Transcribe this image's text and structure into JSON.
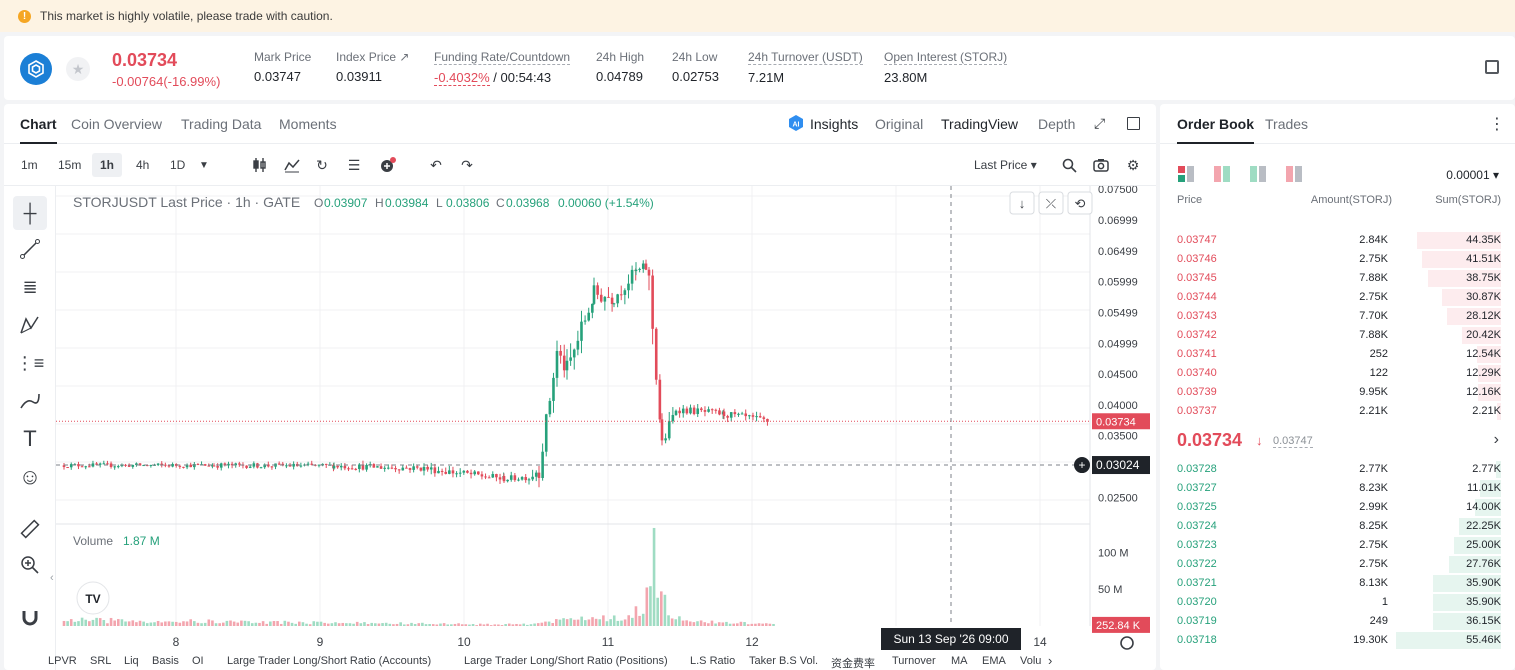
{
  "banner": {
    "message": "This market is highly volatile, please trade with caution."
  },
  "ticker": {
    "last_price": "0.03734",
    "change": "-0.00764(-16.99%)",
    "stats": [
      {
        "label": "Mark Price",
        "value": "0.03747",
        "x": 250
      },
      {
        "label": "Index Price ↗",
        "value": "0.03911",
        "x": 332
      },
      {
        "label": "Funding Rate/Countdown",
        "value_neg": "-0.4032%",
        "value_rest": " / 00:54:43",
        "x": 430,
        "ul": true
      },
      {
        "label": "24h High",
        "value": "0.04789",
        "x": 592
      },
      {
        "label": "24h Low",
        "value": "0.02753",
        "x": 668
      },
      {
        "label": "24h Turnover (USDT)",
        "value": "7.21M",
        "x": 744,
        "ul": true
      },
      {
        "label": "Open Interest (STORJ)",
        "value": "23.80M",
        "x": 880,
        "ul": true
      }
    ]
  },
  "chart_tabs": {
    "chart": "Chart",
    "coin_overview": "Coin Overview",
    "trading_data": "Trading Data",
    "moments": "Moments",
    "insights": "Insights",
    "original": "Original",
    "tradingview": "TradingView",
    "depth": "Depth"
  },
  "timeframes": [
    "1m",
    "15m",
    "1h",
    "4h",
    "1D"
  ],
  "price_type": "Last Price ▾",
  "legend": {
    "symbol": "STORJUSDT Last Price · 1h · GATE",
    "o_lbl": "O",
    "o": "0.03907",
    "h_lbl": "H",
    "h": "0.03984",
    "l_lbl": "L",
    "l": "0.03806",
    "c_lbl": "C",
    "c": "0.03968",
    "chg": "0.00060 (+1.54%)"
  },
  "volume_legend": {
    "label": "Volume",
    "value": "1.87 M"
  },
  "bottom_indicators": [
    "LPVR",
    "SRL",
    "Liq",
    "Basis",
    "OI",
    "Large Trader Long/Short Ratio (Accounts)",
    "Large Trader Long/Short Ratio (Positions)",
    "L.S Ratio",
    "Taker B.S Vol.",
    "资金费率",
    "Turnover",
    "MA",
    "EMA",
    "Volu"
  ],
  "chart_data": {
    "type": "candlestick",
    "price_axis_ticks": [
      "0.07500",
      "0.06999",
      "0.06499",
      "0.05999",
      "0.05499",
      "0.04999",
      "0.04500",
      "0.04000",
      "0.03500",
      "0.02500"
    ],
    "volume_axis_ticks": [
      "100 M",
      "50 M"
    ],
    "x_ticks": [
      "8",
      "9",
      "10",
      "11",
      "12",
      "14"
    ],
    "last_price_label": "0.03734",
    "crosshair_price_label": "0.03024",
    "crosshair_time_label": "Sun 13 Sep '26   09:00",
    "last_volume_label": "252.84 K",
    "ylim": [
      0.021,
      0.0755
    ],
    "vol_max": 125,
    "segments": [
      [
        0,
        0.0302,
        0.0302,
        150,
        0.00035
      ],
      [
        150,
        0.0302,
        0.0301,
        270,
        0.0004
      ],
      [
        270,
        0.0301,
        0.0297,
        360,
        0.0005
      ],
      [
        360,
        0.0297,
        0.028,
        440,
        0.0006
      ],
      [
        440,
        0.028,
        0.0283,
        465,
        0.0005
      ],
      [
        465,
        0.0283,
        0.0296,
        475,
        0.0009
      ],
      [
        475,
        0.0296,
        0.0485,
        493,
        0.0015
      ],
      [
        493,
        0.0485,
        0.0455,
        503,
        0.0015
      ],
      [
        503,
        0.0455,
        0.058,
        530,
        0.0018
      ],
      [
        530,
        0.058,
        0.0575,
        550,
        0.0015
      ],
      [
        550,
        0.0575,
        0.0615,
        572,
        0.0012
      ],
      [
        572,
        0.0615,
        0.0622,
        582,
        0.001
      ],
      [
        582,
        0.0622,
        0.06,
        585,
        0.0008
      ],
      [
        585,
        0.06,
        0.0335,
        598,
        0.002
      ],
      [
        598,
        0.0335,
        0.0393,
        612,
        0.0012
      ],
      [
        612,
        0.0393,
        0.0385,
        660,
        0.0006
      ],
      [
        660,
        0.0385,
        0.0373,
        705,
        0.0006
      ]
    ],
    "volume_bars": [
      [
        0,
        8
      ],
      [
        440,
        2
      ],
      [
        465,
        3
      ],
      [
        475,
        6
      ],
      [
        495,
        7
      ],
      [
        520,
        12
      ],
      [
        545,
        10
      ],
      [
        560,
        9
      ],
      [
        570,
        18
      ],
      [
        576,
        26
      ],
      [
        580,
        18
      ],
      [
        585,
        80
      ],
      [
        590,
        120
      ],
      [
        595,
        55
      ],
      [
        605,
        18
      ],
      [
        620,
        6
      ],
      [
        705,
        3
      ]
    ]
  },
  "orderbook": {
    "tabs": {
      "order_book": "Order Book",
      "trades": "Trades"
    },
    "precision": "0.00001 ▾",
    "headers": {
      "price": "Price",
      "amount": "Amount(STORJ)",
      "sum": "Sum(STORJ)"
    },
    "asks": [
      {
        "price": "0.03747",
        "amount": "2.84K",
        "sum": "44.35K",
        "depth": 0.8
      },
      {
        "price": "0.03746",
        "amount": "2.75K",
        "sum": "41.51K",
        "depth": 0.75
      },
      {
        "price": "0.03745",
        "amount": "7.88K",
        "sum": "38.75K",
        "depth": 0.7
      },
      {
        "price": "0.03744",
        "amount": "2.75K",
        "sum": "30.87K",
        "depth": 0.56
      },
      {
        "price": "0.03743",
        "amount": "7.70K",
        "sum": "28.12K",
        "depth": 0.51
      },
      {
        "price": "0.03742",
        "amount": "7.88K",
        "sum": "20.42K",
        "depth": 0.37
      },
      {
        "price": "0.03741",
        "amount": "252",
        "sum": "12.54K",
        "depth": 0.23
      },
      {
        "price": "0.03740",
        "amount": "122",
        "sum": "12.29K",
        "depth": 0.22
      },
      {
        "price": "0.03739",
        "amount": "9.95K",
        "sum": "12.16K",
        "depth": 0.22
      },
      {
        "price": "0.03737",
        "amount": "2.21K",
        "sum": "2.21K",
        "depth": 0.04
      }
    ],
    "mid_price": "0.03734",
    "mid_arrow": "↓",
    "mark_price": "0.03747",
    "bids": [
      {
        "price": "0.03728",
        "amount": "2.77K",
        "sum": "2.77K",
        "depth": 0.05
      },
      {
        "price": "0.03727",
        "amount": "8.23K",
        "sum": "11.01K",
        "depth": 0.2
      },
      {
        "price": "0.03725",
        "amount": "2.99K",
        "sum": "14.00K",
        "depth": 0.25
      },
      {
        "price": "0.03724",
        "amount": "8.25K",
        "sum": "22.25K",
        "depth": 0.4
      },
      {
        "price": "0.03723",
        "amount": "2.75K",
        "sum": "25.00K",
        "depth": 0.45
      },
      {
        "price": "0.03722",
        "amount": "2.75K",
        "sum": "27.76K",
        "depth": 0.5
      },
      {
        "price": "0.03721",
        "amount": "8.13K",
        "sum": "35.90K",
        "depth": 0.65
      },
      {
        "price": "0.03720",
        "amount": "1",
        "sum": "35.90K",
        "depth": 0.65
      },
      {
        "price": "0.03719",
        "amount": "249",
        "sum": "36.15K",
        "depth": 0.65
      },
      {
        "price": "0.03718",
        "amount": "19.30K",
        "sum": "55.46K",
        "depth": 1.0
      }
    ]
  },
  "colors": {
    "up": "#26a17b",
    "down": "#e24b5a",
    "up_bg": "#e6f5ef",
    "down_bg": "#fdecee",
    "up_vol": "#9fdcc3",
    "down_vol": "#f3a5ae"
  }
}
